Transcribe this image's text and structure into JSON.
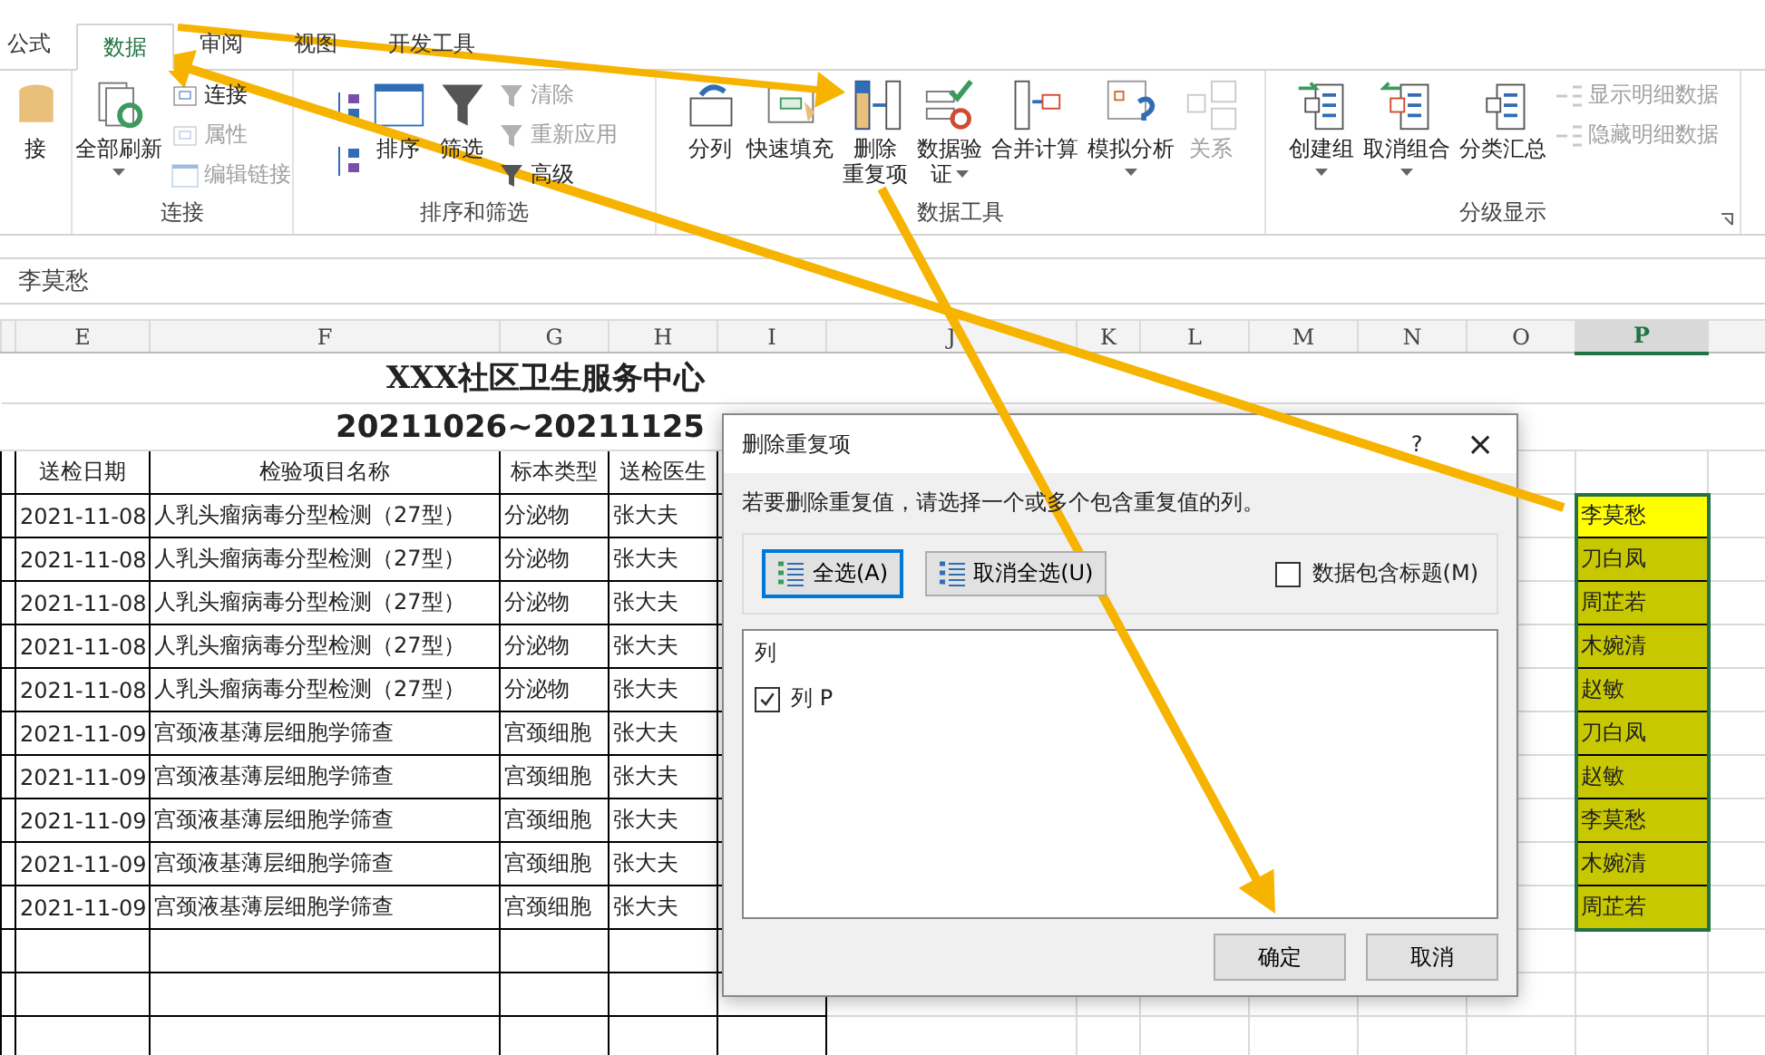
{
  "tabs": [
    {
      "label": "公式",
      "selected": false
    },
    {
      "label": "数据",
      "selected": true
    },
    {
      "label": "审阅",
      "selected": false
    },
    {
      "label": "视图",
      "selected": false
    },
    {
      "label": "开发工具",
      "selected": false
    }
  ],
  "ribbon": {
    "groups": [
      {
        "columns": [
          {
            "kind": "large",
            "lines": [
              "接"
            ],
            "disabled": false,
            "has_menu": false
          }
        ]
      },
      {
        "label": "连接",
        "columns": [
          {
            "kind": "large",
            "lines": [
              "全部刷新"
            ],
            "disabled": false,
            "has_menu": true
          },
          {
            "kind": "stack",
            "items": [
              {
                "label": "连接",
                "disabled": false
              },
              {
                "label": "属性",
                "disabled": true
              },
              {
                "label": "编辑链接",
                "disabled": true
              }
            ]
          }
        ]
      },
      {
        "label": "排序和筛选",
        "columns": [
          {
            "kind": "sortpair"
          },
          {
            "kind": "large",
            "lines": [
              "排序"
            ],
            "disabled": false,
            "has_menu": false
          },
          {
            "kind": "large",
            "lines": [
              "筛选"
            ],
            "disabled": false,
            "has_menu": false
          },
          {
            "kind": "stack",
            "items": [
              {
                "label": "清除",
                "disabled": true
              },
              {
                "label": "重新应用",
                "disabled": true
              },
              {
                "label": "高级",
                "disabled": false
              }
            ]
          }
        ]
      },
      {
        "label": "数据工具",
        "columns": [
          {
            "kind": "large",
            "lines": [
              "分列"
            ],
            "disabled": false,
            "has_menu": false
          },
          {
            "kind": "large",
            "lines": [
              "快速填充"
            ],
            "disabled": false,
            "has_menu": false
          },
          {
            "kind": "large",
            "lines": [
              "删除",
              "重复项"
            ],
            "disabled": false,
            "has_menu": false
          },
          {
            "kind": "large",
            "lines": [
              "数据验",
              "证"
            ],
            "disabled": false,
            "has_menu": true
          },
          {
            "kind": "large",
            "lines": [
              "合并计算"
            ],
            "disabled": false,
            "has_menu": false
          },
          {
            "kind": "large",
            "lines": [
              "模拟分析"
            ],
            "disabled": false,
            "has_menu": true
          },
          {
            "kind": "large",
            "lines": [
              "关系"
            ],
            "disabled": true,
            "has_menu": false
          }
        ]
      },
      {
        "label": "分级显示",
        "launcher": true,
        "columns": [
          {
            "kind": "large",
            "lines": [
              "创建组"
            ],
            "disabled": false,
            "has_menu": true
          },
          {
            "kind": "large",
            "lines": [
              "取消组合"
            ],
            "disabled": false,
            "has_menu": true
          },
          {
            "kind": "large",
            "lines": [
              "分类汇总"
            ],
            "disabled": false,
            "has_menu": false
          },
          {
            "kind": "stack",
            "items": [
              {
                "label": "显示明细数据",
                "disabled": true
              },
              {
                "label": "隐藏明细数据",
                "disabled": true
              }
            ]
          }
        ]
      }
    ]
  },
  "formula_bar": {
    "value": "李莫愁"
  },
  "sheet": {
    "columns": [
      {
        "label": "E",
        "selected": false
      },
      {
        "label": "F",
        "selected": false
      },
      {
        "label": "G",
        "selected": false
      },
      {
        "label": "H",
        "selected": false
      },
      {
        "label": "I",
        "selected": false
      },
      {
        "label": "J",
        "selected": false
      },
      {
        "label": "K",
        "selected": false
      },
      {
        "label": "L",
        "selected": false
      },
      {
        "label": "M",
        "selected": false
      },
      {
        "label": "N",
        "selected": false
      },
      {
        "label": "O",
        "selected": false
      },
      {
        "label": "P",
        "selected": true
      }
    ],
    "title": "XXX社区卫生服务中心",
    "subtitle": "20211026~20211125",
    "headers": [
      "送检日期",
      "检验项目名称",
      "标本类型",
      "送检医生"
    ],
    "rows": [
      {
        "date": "2021-11-08",
        "item": "人乳头瘤病毒分型检测（27型）",
        "specimen": "分泌物",
        "doctor": "张大夫",
        "column_p": {
          "text": "李莫愁",
          "color": "#ffff00"
        }
      },
      {
        "date": "2021-11-08",
        "item": "人乳头瘤病毒分型检测（27型）",
        "specimen": "分泌物",
        "doctor": "张大夫",
        "column_p": {
          "text": "刀白凤",
          "color": "#c8c800"
        }
      },
      {
        "date": "2021-11-08",
        "item": "人乳头瘤病毒分型检测（27型）",
        "specimen": "分泌物",
        "doctor": "张大夫",
        "column_p": {
          "text": "周芷若",
          "color": "#c8c800"
        }
      },
      {
        "date": "2021-11-08",
        "item": "人乳头瘤病毒分型检测（27型）",
        "specimen": "分泌物",
        "doctor": "张大夫",
        "column_p": {
          "text": "木婉清",
          "color": "#c8c800"
        }
      },
      {
        "date": "2021-11-08",
        "item": "人乳头瘤病毒分型检测（27型）",
        "specimen": "分泌物",
        "doctor": "张大夫",
        "column_p": {
          "text": "赵敏",
          "color": "#c8c800"
        }
      },
      {
        "date": "2021-11-09",
        "item": "宫颈液基薄层细胞学筛查",
        "specimen": "宫颈细胞",
        "doctor": "张大夫",
        "column_p": {
          "text": "刀白凤",
          "color": "#c8c800"
        }
      },
      {
        "date": "2021-11-09",
        "item": "宫颈液基薄层细胞学筛查",
        "specimen": "宫颈细胞",
        "doctor": "张大夫",
        "column_p": {
          "text": "赵敏",
          "color": "#c8c800"
        }
      },
      {
        "date": "2021-11-09",
        "item": "宫颈液基薄层细胞学筛查",
        "specimen": "宫颈细胞",
        "doctor": "张大夫",
        "column_p": {
          "text": "李莫愁",
          "color": "#c8c800"
        }
      },
      {
        "date": "2021-11-09",
        "item": "宫颈液基薄层细胞学筛查",
        "specimen": "宫颈细胞",
        "doctor": "张大夫",
        "column_p": {
          "text": "木婉清",
          "color": "#c8c800"
        }
      },
      {
        "date": "2021-11-09",
        "item": "宫颈液基薄层细胞学筛查",
        "specimen": "宫颈细胞",
        "doctor": "张大夫",
        "column_p": {
          "text": "周芷若",
          "color": "#c8c800"
        }
      }
    ]
  },
  "dialog": {
    "title": "删除重复项",
    "help": "?",
    "close": "×",
    "instruction": "若要删除重复值，请选择一个或多个包含重复值的列。",
    "select_buttons": [
      {
        "label": "全选(A)",
        "default": true
      },
      {
        "label": "取消全选(U)",
        "default": false
      }
    ],
    "header_option": {
      "label": "数据包含标题(M)",
      "checked": false
    },
    "list_header": "列",
    "columns": [
      {
        "label": "列 P",
        "checked": true
      }
    ],
    "buttons": [
      {
        "label": "确定"
      },
      {
        "label": "取消"
      }
    ]
  }
}
